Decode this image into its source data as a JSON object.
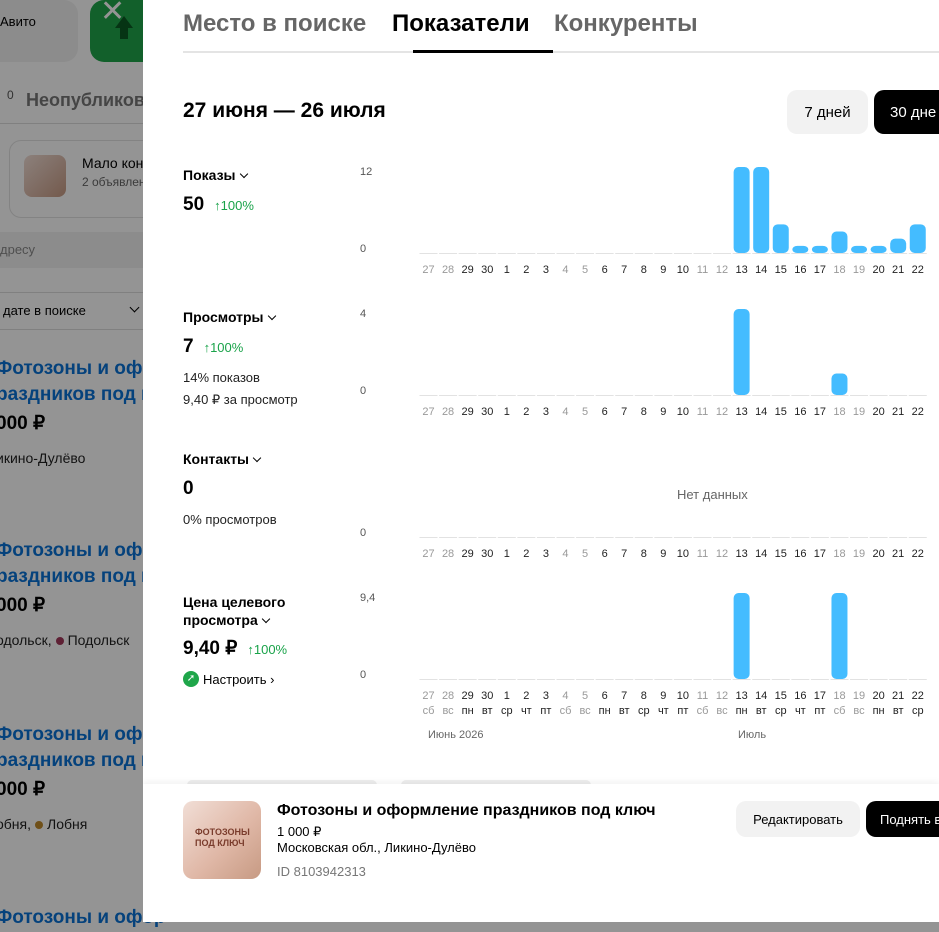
{
  "background": {
    "logo_text": "Авито",
    "tab_label": "Неопубликов",
    "tab_count": "0",
    "notice_title": "Мало конт",
    "notice_sub": "2 объявлен",
    "address_placeholder": "дресу",
    "sort_label": "дате в поиске",
    "listings": [
      {
        "line1": "Фотозоны и офор",
        "line2": "раздников под к",
        "price": "000 ₽",
        "loc": "икино-Дулёво",
        "dot1": "",
        "dot_color": ""
      },
      {
        "line1": "Фотозоны и офор",
        "line2": "раздников под к",
        "price": "000 ₽",
        "loc": "одольск,",
        "dot1": "Подольск",
        "dot_color": "#a3385b"
      },
      {
        "line1": "Фотозоны и офор",
        "line2": "раздников под к",
        "price": "000 ₽",
        "loc": "обня,",
        "dot1": "Лобня",
        "dot_color": "#c08a2c"
      },
      {
        "line1": "Фотозоны и офор",
        "line2": "",
        "price": "",
        "loc": "",
        "dot1": "",
        "dot_color": ""
      }
    ]
  },
  "modal": {
    "tabs": [
      "Место в поиске",
      "Показатели",
      "Конкуренты"
    ],
    "active_tab": 1,
    "date_range": "27 июня — 26 июля",
    "period_buttons": [
      "7 дней",
      "30 дне"
    ],
    "metrics": [
      {
        "title": "Показы",
        "value": "50",
        "change": "↑100%",
        "sub1": "",
        "sub2": "",
        "ymax": "12",
        "ymin": "0"
      },
      {
        "title": "Просмотры",
        "value": "7",
        "change": "↑100%",
        "sub1": "14% показов",
        "sub2": "9,40 ₽ за просмотр",
        "ymax": "4",
        "ymin": "0"
      },
      {
        "title": "Контакты",
        "value": "0",
        "change": "",
        "sub1": "0% просмотров",
        "sub2": "",
        "ymax": "",
        "ymin": "0"
      },
      {
        "title_line1": "Цена целевого",
        "title": "просмотра",
        "value": "9,40 ₽",
        "change": "↑100%",
        "sub1": "",
        "sub2": "",
        "ymax": "9,4",
        "ymin": "0"
      }
    ],
    "no_data": "Нет данных",
    "setup_link": "Настроить ›",
    "months": [
      "Июнь 2026",
      "Июль"
    ]
  },
  "chart_data": [
    {
      "type": "bar",
      "title": "Показы",
      "categories": [
        "27",
        "28",
        "29",
        "30",
        "1",
        "2",
        "3",
        "4",
        "5",
        "6",
        "7",
        "8",
        "9",
        "10",
        "11",
        "12",
        "13",
        "14",
        "15",
        "16",
        "17",
        "18",
        "19",
        "20",
        "21",
        "22"
      ],
      "values": [
        0,
        0,
        0,
        0,
        0,
        0,
        0,
        0,
        0,
        0,
        0,
        0,
        0,
        0,
        0,
        0,
        12,
        12,
        4,
        1,
        1,
        3,
        1,
        1,
        2,
        4
      ],
      "ylim": [
        0,
        12
      ],
      "color": "#44bcff"
    },
    {
      "type": "bar",
      "title": "Просмотры",
      "categories": [
        "27",
        "28",
        "29",
        "30",
        "1",
        "2",
        "3",
        "4",
        "5",
        "6",
        "7",
        "8",
        "9",
        "10",
        "11",
        "12",
        "13",
        "14",
        "15",
        "16",
        "17",
        "18",
        "19",
        "20",
        "21",
        "22"
      ],
      "values": [
        0,
        0,
        0,
        0,
        0,
        0,
        0,
        0,
        0,
        0,
        0,
        0,
        0,
        0,
        0,
        0,
        4,
        0,
        0,
        0,
        0,
        1,
        0,
        0,
        0,
        0
      ],
      "ylim": [
        0,
        4
      ],
      "color": "#44bcff"
    },
    {
      "type": "bar",
      "title": "Контакты",
      "categories": [
        "27",
        "28",
        "29",
        "30",
        "1",
        "2",
        "3",
        "4",
        "5",
        "6",
        "7",
        "8",
        "9",
        "10",
        "11",
        "12",
        "13",
        "14",
        "15",
        "16",
        "17",
        "18",
        "19",
        "20",
        "21",
        "22"
      ],
      "values": [
        0,
        0,
        0,
        0,
        0,
        0,
        0,
        0,
        0,
        0,
        0,
        0,
        0,
        0,
        0,
        0,
        0,
        0,
        0,
        0,
        0,
        0,
        0,
        0,
        0,
        0
      ],
      "ylim": [
        0,
        0
      ],
      "color": "#44bcff"
    },
    {
      "type": "bar",
      "title": "Цена целевого просмотра",
      "categories": [
        "27",
        "28",
        "29",
        "30",
        "1",
        "2",
        "3",
        "4",
        "5",
        "6",
        "7",
        "8",
        "9",
        "10",
        "11",
        "12",
        "13",
        "14",
        "15",
        "16",
        "17",
        "18",
        "19",
        "20",
        "21",
        "22"
      ],
      "weekdays": [
        "сб",
        "вс",
        "пн",
        "вт",
        "ср",
        "чт",
        "пт",
        "сб",
        "вс",
        "пн",
        "вт",
        "ср",
        "чт",
        "пт",
        "сб",
        "вс",
        "пн",
        "вт",
        "ср",
        "чт",
        "пт",
        "сб",
        "вс",
        "пн",
        "вт",
        "ср"
      ],
      "values": [
        0,
        0,
        0,
        0,
        0,
        0,
        0,
        0,
        0,
        0,
        0,
        0,
        0,
        0,
        0,
        0,
        9.4,
        0,
        0,
        0,
        0,
        9.4,
        0,
        0,
        0,
        0
      ],
      "ylim": [
        0,
        9.4
      ],
      "color": "#44bcff"
    }
  ],
  "weekend_label_color": "#999999",
  "listing_card": {
    "title": "Фотозоны и оформление праздников под ключ",
    "price": "1 000 ₽",
    "location": "Московская обл., Ликино-Дулёво",
    "id": "ID 8103942313",
    "thumb_text": "ФОТОЗОНЫ ПОД КЛЮЧ",
    "edit_button": "Редактировать",
    "raise_button": "Поднять в"
  }
}
